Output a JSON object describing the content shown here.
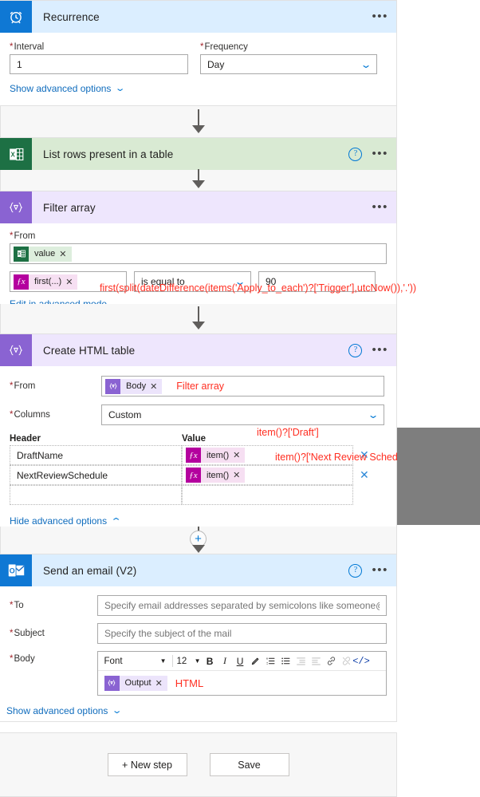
{
  "recurrence": {
    "title": "Recurrence",
    "icon": "alarm-clock-icon",
    "more_label": "•••",
    "interval_label": "Interval",
    "interval_value": "1",
    "frequency_label": "Frequency",
    "frequency_value": "Day",
    "advanced_link": "Show advanced options"
  },
  "list_rows": {
    "title": "List rows present in a table",
    "icon": "excel-icon",
    "help_label": "?",
    "more_label": "•••"
  },
  "filter_array": {
    "title": "Filter array",
    "icon": "filter-array-icon",
    "more_label": "•••",
    "from_label": "From",
    "from_token": "value",
    "left_token": "first(...)",
    "operator": "is equal to",
    "right_value": "90",
    "advanced_link": "Edit in advanced mode",
    "annotation": "first(split(dateDifference(items('Apply_to_each')?['Trigger'],utcNow()),'.'))"
  },
  "create_html_table": {
    "title": "Create HTML table",
    "icon": "filter-array-icon",
    "help_label": "?",
    "more_label": "•••",
    "from_label": "From",
    "from_token": "Body",
    "from_annotation": "Filter array",
    "columns_label": "Columns",
    "columns_value": "Custom",
    "header_col_label": "Header",
    "value_col_label": "Value",
    "rows": [
      {
        "header": "DraftName",
        "token": "item()",
        "annotation": "item()?['Draft']",
        "delete_label": "✕"
      },
      {
        "header": "NextReviewSchedule",
        "token": "item()",
        "annotation": "item()?['Next Review Schedule']",
        "delete_label": "✕"
      },
      {
        "header": "",
        "token": "",
        "annotation": "",
        "delete_label": ""
      }
    ],
    "advanced_link": "Hide advanced options"
  },
  "insert_button": {
    "label": "+"
  },
  "send_email": {
    "title": "Send an email (V2)",
    "icon": "outlook-icon",
    "help_label": "?",
    "more_label": "•••",
    "to_label": "To",
    "to_placeholder": "Specify email addresses separated by semicolons like someone@c...",
    "subject_label": "Subject",
    "subject_placeholder": "Specify the subject of the mail",
    "body_label": "Body",
    "toolbar": {
      "font_name": "Font",
      "font_size": "12",
      "bold": "B",
      "italic": "I",
      "underline": "U",
      "text_color": "pen-icon",
      "numbered_list": "numbered-list-icon",
      "bulleted_list": "bulleted-list-icon",
      "outdent": "outdent-icon",
      "indent": "indent-icon",
      "link": "link-icon",
      "unlink": "unlink-icon",
      "code_view": "</>"
    },
    "body_token": "Output",
    "body_annotation": "HTML",
    "advanced_link": "Show advanced options"
  },
  "footer": {
    "new_step_label": "+ New step",
    "save_label": "Save"
  },
  "colors": {
    "accent_blue": "#0078d4",
    "annotation_red": "#ff2e21",
    "excel_green": "#1d7044",
    "purple": "#8a63d2",
    "gray_overlay": "#7e7e7e"
  }
}
